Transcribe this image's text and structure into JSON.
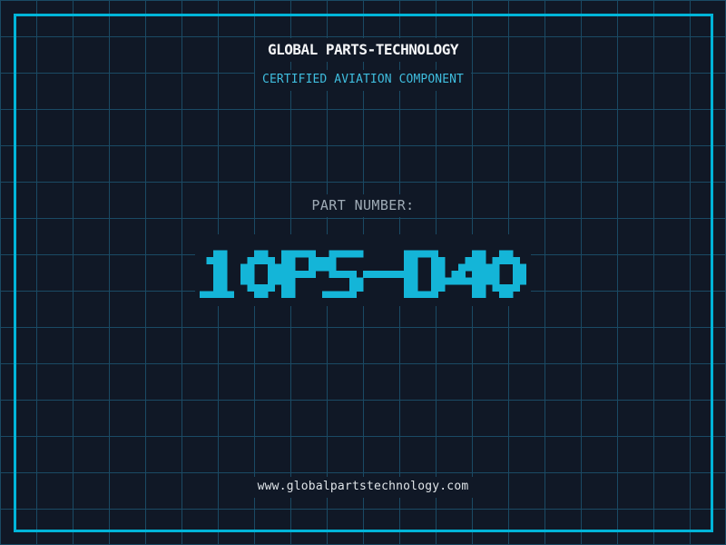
{
  "theme": {
    "background": "#101826",
    "grid_line": "#1a4a64",
    "frame_border": "#00b5d9"
  },
  "header": {
    "title": "GLOBAL PARTS-TECHNOLOGY",
    "title_color": "#f5f6f8",
    "subtitle": "CERTIFIED AVIATION COMPONENT",
    "subtitle_color": "#3fbdde"
  },
  "part": {
    "label": "PART NUMBER:",
    "label_color": "#9fabb6",
    "number": "10PS-D40",
    "number_color": "#14b5d8"
  },
  "footer": {
    "website": "www.globalpartstechnology.com",
    "website_color": "#dfe4e8"
  }
}
